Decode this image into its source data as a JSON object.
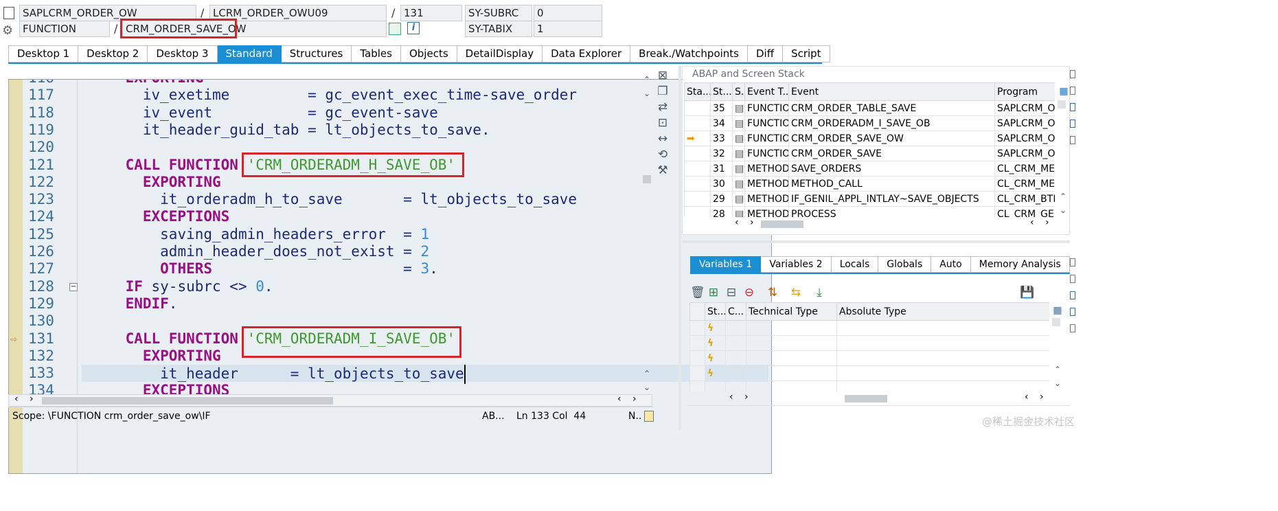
{
  "header": {
    "program": "SAPLCRM_ORDER_OW",
    "include": "LCRM_ORDER_OWU09",
    "line": "131",
    "subrc_label": "SY-SUBRC",
    "subrc_value": "0",
    "event_type": "FUNCTION",
    "event_name": "CRM_ORDER_SAVE_OW",
    "tabix_label": "SY-TABIX",
    "tabix_value": "1",
    "slash": "/"
  },
  "tabs": [
    "Desktop 1",
    "Desktop 2",
    "Desktop 3",
    "Standard",
    "Structures",
    "Tables",
    "Objects",
    "DetailDisplay",
    "Data Explorer",
    "Break./Watchpoints",
    "Diff",
    "Script"
  ],
  "active_tab": "Standard",
  "code": {
    "lines": [
      {
        "n": "116",
        "t": [
          [
            "kw",
            "EXPORTING"
          ]
        ],
        "i": 2
      },
      {
        "n": "117",
        "t": [
          [
            "p",
            "iv_exetime         = gc_event_exec_time-save_order"
          ]
        ],
        "i": 3
      },
      {
        "n": "118",
        "t": [
          [
            "p",
            "iv_event           = gc_event-save"
          ]
        ],
        "i": 3
      },
      {
        "n": "119",
        "t": [
          [
            "p",
            "it_header_guid_tab = lt_objects_to_save."
          ]
        ],
        "i": 3
      },
      {
        "n": "120",
        "t": [],
        "i": 0
      },
      {
        "n": "121",
        "t": [
          [
            "kw",
            "CALL FUNCTION "
          ],
          [
            "str",
            "'CRM_ORDERADM_H_SAVE_OB'"
          ]
        ],
        "i": 2
      },
      {
        "n": "122",
        "t": [
          [
            "kw",
            "EXPORTING"
          ]
        ],
        "i": 3
      },
      {
        "n": "123",
        "t": [
          [
            "p",
            "it_orderadm_h_to_save       = lt_objects_to_save"
          ]
        ],
        "i": 4
      },
      {
        "n": "124",
        "t": [
          [
            "kw",
            "EXCEPTIONS"
          ]
        ],
        "i": 3
      },
      {
        "n": "125",
        "t": [
          [
            "p",
            "saving_admin_headers_error  = "
          ],
          [
            "num",
            "1"
          ]
        ],
        "i": 4
      },
      {
        "n": "126",
        "t": [
          [
            "p",
            "admin_header_does_not_exist = "
          ],
          [
            "num",
            "2"
          ]
        ],
        "i": 4
      },
      {
        "n": "127",
        "t": [
          [
            "kw",
            "OTHERS"
          ],
          [
            "p",
            "                      = "
          ],
          [
            "num",
            "3"
          ],
          [
            "p",
            "."
          ]
        ],
        "i": 4
      },
      {
        "n": "128",
        "t": [
          [
            "kw",
            "IF "
          ],
          [
            "p",
            "sy-subrc <> "
          ],
          [
            "num",
            "0"
          ],
          [
            "p",
            "."
          ]
        ],
        "i": 2
      },
      {
        "n": "129",
        "t": [
          [
            "kw",
            "ENDIF"
          ],
          [
            "p",
            "."
          ]
        ],
        "i": 2
      },
      {
        "n": "130",
        "t": [],
        "i": 0
      },
      {
        "n": "131",
        "t": [
          [
            "kw",
            "CALL FUNCTION "
          ],
          [
            "str",
            "'CRM_ORDERADM_I_SAVE_OB'"
          ]
        ],
        "i": 2
      },
      {
        "n": "132",
        "t": [
          [
            "kw",
            "EXPORTING"
          ]
        ],
        "i": 3
      },
      {
        "n": "133",
        "t": [
          [
            "p",
            "it_header      = lt_objects_to_save"
          ]
        ],
        "i": 4
      },
      {
        "n": "134",
        "t": [
          [
            "kw",
            "EXCEPTIONS"
          ]
        ],
        "i": 3
      }
    ]
  },
  "status": {
    "scope": "Scope: \\FUNCTION crm_order_save_ow\\IF",
    "lang": "AB...",
    "pos": "Ln 133 Col  44",
    "mode": "N.."
  },
  "stack": {
    "title": "ABAP and Screen Stack",
    "columns": [
      "Sta...",
      "St...",
      "S..",
      "Event T...",
      "Event",
      "Program"
    ],
    "rows": [
      {
        "st": "35",
        "type": "FUNCTIO...",
        "event": "CRM_ORDER_TABLE_SAVE",
        "program": "SAPLCRM_ORDER_OW",
        "current": false
      },
      {
        "st": "34",
        "type": "FUNCTIO...",
        "event": "CRM_ORDERADM_I_SAVE_OB",
        "program": "SAPLCRM_ORDERADM_I",
        "current": false
      },
      {
        "st": "33",
        "type": "FUNCTIO...",
        "event": "CRM_ORDER_SAVE_OW",
        "program": "SAPLCRM_ORDER_OW",
        "current": true
      },
      {
        "st": "32",
        "type": "FUNCTIO...",
        "event": "CRM_ORDER_SAVE",
        "program": "SAPLCRM_ORDER",
        "current": false
      },
      {
        "st": "31",
        "type": "METHOD",
        "event": "SAVE_ORDERS",
        "program": "CL_CRM_METHOD",
        "current": false
      },
      {
        "st": "30",
        "type": "METHOD",
        "event": "METHOD_CALL",
        "program": "CL_CRM_METHOD",
        "current": false
      },
      {
        "st": "29",
        "type": "METHOD",
        "event": "IF_GENIL_APPL_INTLAY~SAVE_OBJECTS",
        "program": "CL_CRM_BTIL",
        "current": false
      },
      {
        "st": "28",
        "type": "METHOD",
        "event": "PROCESS",
        "program": "CL_CRM_GENIL",
        "current": false
      }
    ]
  },
  "variables": {
    "tabs": [
      "Variables 1",
      "Variables 2",
      "Locals",
      "Globals",
      "Auto",
      "Memory Analysis"
    ],
    "active": "Variables 1",
    "columns": [
      "St...",
      "C...",
      "Technical Type",
      "Absolute Type"
    ],
    "row_count": 4
  },
  "watermark": "@稀土掘金技术社区"
}
